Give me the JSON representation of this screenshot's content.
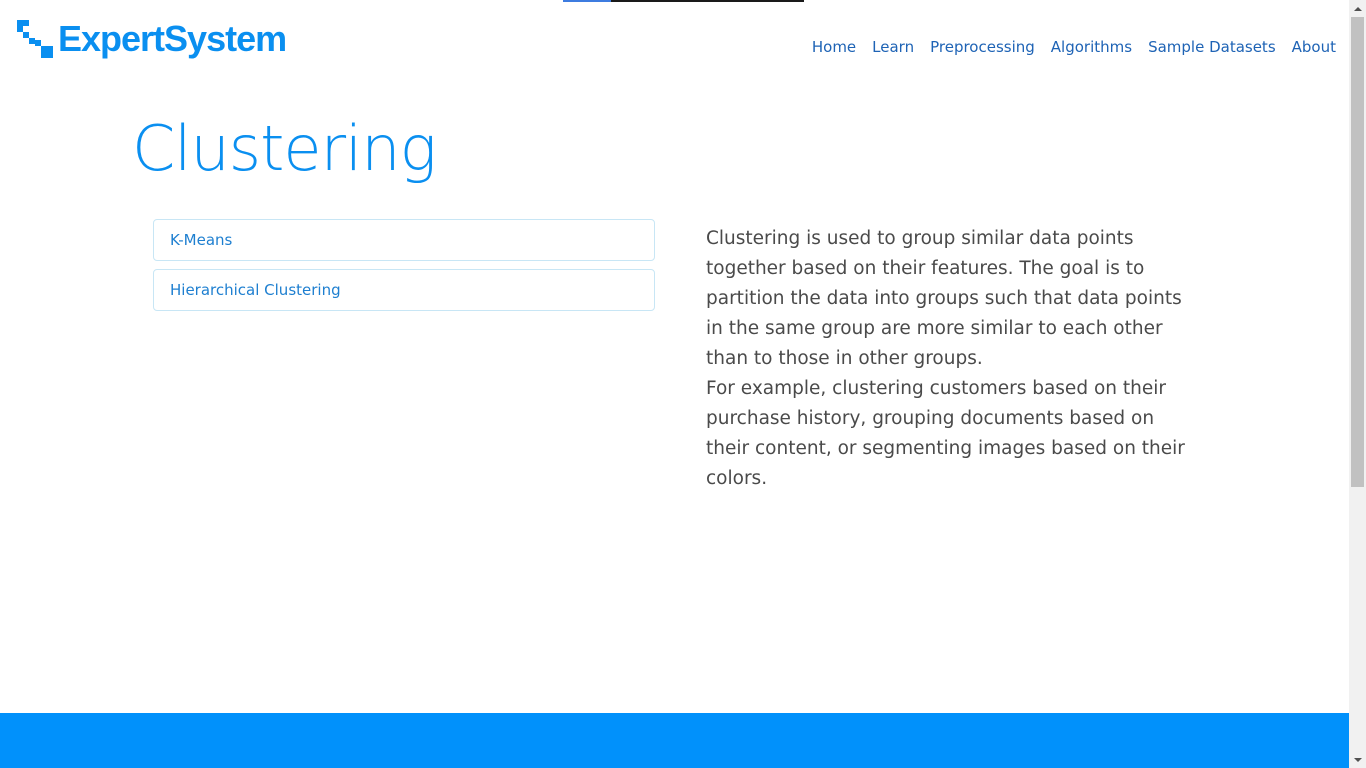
{
  "brand": {
    "name": "ExpertSystem",
    "logo_icon": "expert-system-logo-mark",
    "color": "#0a8ff0"
  },
  "nav": {
    "items": [
      {
        "label": "Home"
      },
      {
        "label": "Learn"
      },
      {
        "label": "Preprocessing"
      },
      {
        "label": "Algorithms"
      },
      {
        "label": "Sample Datasets"
      },
      {
        "label": "About"
      }
    ]
  },
  "main": {
    "title": "Clustering",
    "algorithms": [
      {
        "label": "K-Means"
      },
      {
        "label": "Hierarchical Clustering"
      }
    ],
    "description": {
      "paragraph1": "Clustering is used to group similar data points together based on their features. The goal is to partition the data into groups such that data points in the same group are more similar to each other than to those in other groups.",
      "paragraph2": "For example, clustering customers based on their purchase history, grouping documents based on their content, or segmenting images based on their colors."
    }
  },
  "colors": {
    "accent": "#0a8ff0",
    "nav_link": "#1e63b5",
    "footer": "#0191fb",
    "body_text": "#4a4a4a"
  }
}
